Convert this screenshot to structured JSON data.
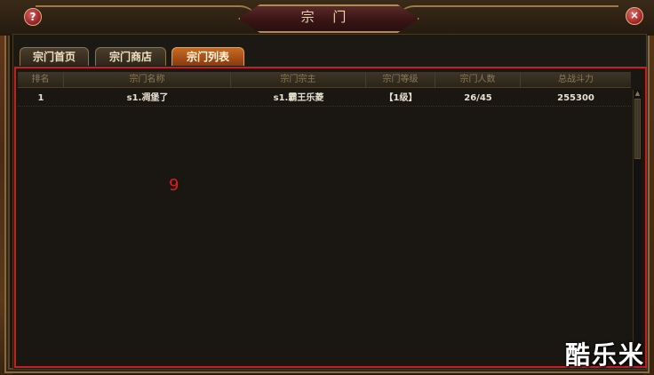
{
  "window": {
    "title": "宗 门",
    "help_icon": "?",
    "close_icon": "×"
  },
  "tabs": [
    {
      "label": "宗门首页",
      "active": false
    },
    {
      "label": "宗门商店",
      "active": false
    },
    {
      "label": "宗门列表",
      "active": true
    }
  ],
  "table": {
    "columns": [
      "排名",
      "宗门名称",
      "宗门宗主",
      "宗门等级",
      "宗门人数",
      "总战斗力"
    ],
    "rows": [
      [
        "1",
        "s1.凋堡了",
        "s1.霸王乐菱",
        "【1级】",
        "26/45",
        "255300"
      ]
    ]
  },
  "annotation_number": "9",
  "watermark": "酷乐米",
  "colors": {
    "accent_tab": "#c86a20",
    "highlight_border": "#c81e1e",
    "annotation": "#d82020"
  }
}
